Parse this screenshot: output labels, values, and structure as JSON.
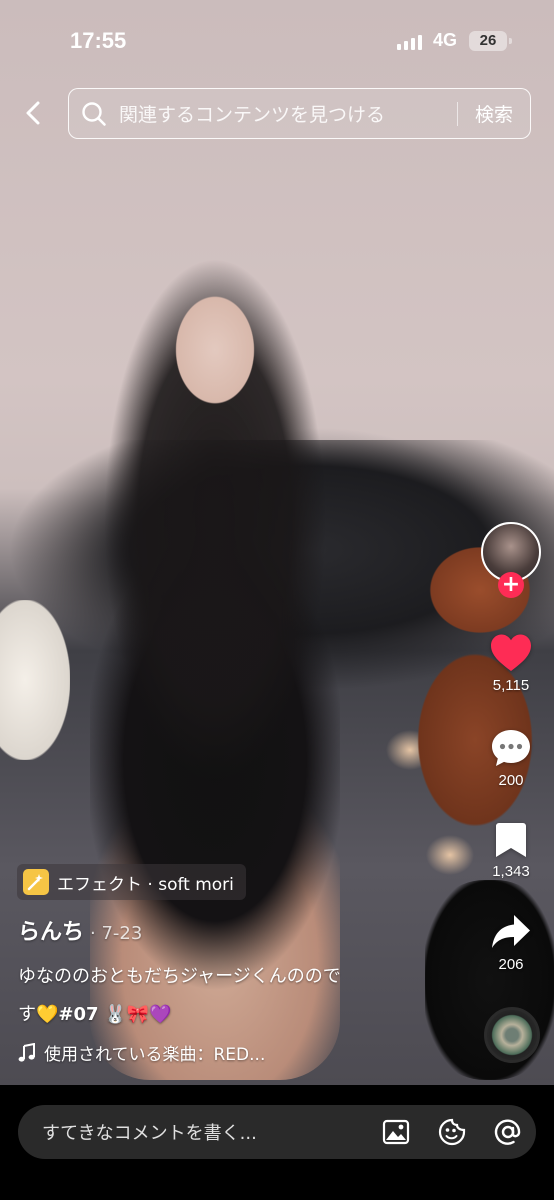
{
  "status_bar": {
    "time": "17:55",
    "network": "4G",
    "battery": "26"
  },
  "search": {
    "placeholder": "関連するコンテンツを見つける",
    "button_label": "検索"
  },
  "actions": {
    "likes": "5,115",
    "comments": "200",
    "bookmarks": "1,343",
    "shares": "206",
    "follow_symbol": "+"
  },
  "post": {
    "effect_label": "エフェクト · soft mori",
    "username": "らんち",
    "date": "· 7-23",
    "caption_line1": "ゆなののおともだちジャージくんのので",
    "caption_line2_text": "す💛",
    "caption_hashtag": "#07",
    "caption_line2_emoji": " 🐰🎀💜",
    "music_label": "使用されている楽曲：RED..."
  },
  "comment_bar": {
    "placeholder": "すてきなコメントを書く..."
  },
  "icons": {
    "back": "chevron-left-icon",
    "search": "search-icon",
    "like": "heart-icon",
    "comment": "comment-icon",
    "bookmark": "bookmark-icon",
    "share": "share-icon",
    "music": "music-note-icon",
    "image": "image-icon",
    "emoji": "emoji-icon",
    "mention": "at-icon"
  },
  "colors": {
    "like": "#fe2c55",
    "follow": "#fe2c55",
    "effect_icon": "#f6c545"
  }
}
